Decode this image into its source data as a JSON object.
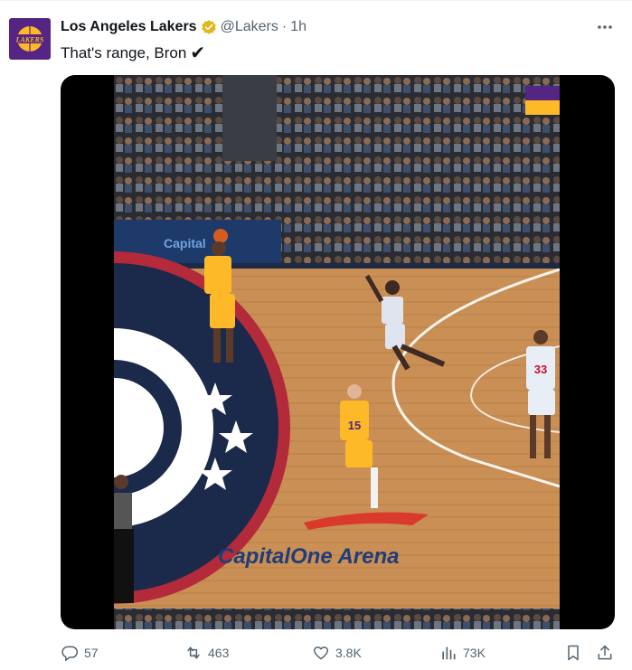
{
  "tweet": {
    "author_name": "Los Angeles Lakers",
    "handle": "@Lakers",
    "separator": "·",
    "time": "1h",
    "text": "That's range, Bron",
    "text_emoji": "✔",
    "avatar_text": "LAKERS"
  },
  "media": {
    "court_logo_text": "CapitalOne Arena",
    "baseline_sign_text": "Capital",
    "jersey_numbers": [
      "15",
      "33"
    ]
  },
  "actions": {
    "replies": "57",
    "reposts": "463",
    "likes": "3.8K",
    "views": "73K"
  },
  "colors": {
    "lakers_purple": "#552583",
    "lakers_gold": "#fdb927",
    "verified_gold": "#e2b719",
    "muted_text": "#536471"
  }
}
